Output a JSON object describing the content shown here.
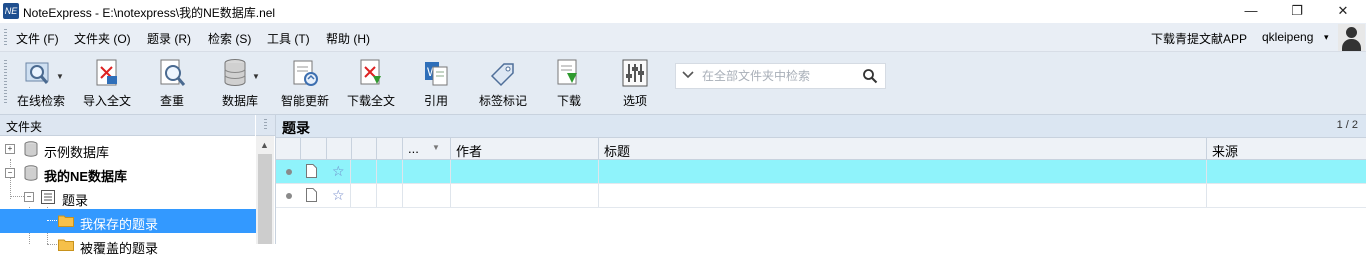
{
  "window": {
    "title": "NoteExpress - E:\\notexpress\\我的NE数据库.nel",
    "logo_text": "NE",
    "controls": {
      "minimize": "—",
      "maximize": "❐",
      "close": "✕"
    }
  },
  "menu": {
    "items": [
      "文件 (F)",
      "文件夹 (O)",
      "题录 (R)",
      "检索 (S)",
      "工具 (T)",
      "帮助 (H)"
    ],
    "download_app": "下载青提文献APP",
    "user": "qkleipeng",
    "user_caret": "▾"
  },
  "toolbar": {
    "tools": [
      {
        "label": "在线检索",
        "icon": "online-search-icon",
        "dropdown": true
      },
      {
        "label": "导入全文",
        "icon": "import-fulltext-icon"
      },
      {
        "label": "查重",
        "icon": "duplicate-check-icon"
      },
      {
        "label": "数据库",
        "icon": "database-icon",
        "dropdown": true
      },
      {
        "label": "智能更新",
        "icon": "smart-update-icon"
      },
      {
        "label": "下载全文",
        "icon": "download-fulltext-icon"
      },
      {
        "label": "引用",
        "icon": "cite-icon"
      },
      {
        "label": "标签标记",
        "icon": "tag-icon"
      },
      {
        "label": "下载",
        "icon": "download-icon"
      },
      {
        "label": "选项",
        "icon": "options-icon"
      }
    ],
    "search": {
      "placeholder": "在全部文件夹中检索",
      "value": ""
    }
  },
  "folders": {
    "header": "文件夹",
    "tree": [
      {
        "label": "示例数据库",
        "bold": false,
        "expander": "+"
      },
      {
        "label": "我的NE数据库",
        "bold": true,
        "expander": "−"
      },
      {
        "label": "题录",
        "bold": false,
        "expander": "−"
      },
      {
        "label": "我保存的题录",
        "bold": false,
        "selected": true
      },
      {
        "label": "被覆盖的题录",
        "bold": false
      }
    ]
  },
  "records": {
    "title": "题录",
    "page": "1 / 2",
    "columns": [
      "...",
      "作者",
      "标题",
      "来源"
    ],
    "sort_caret": "▼",
    "rows": [
      {
        "author": "",
        "title": "",
        "source": "",
        "highlighted": true
      },
      {
        "author": "",
        "title": "",
        "source": "",
        "highlighted": false
      }
    ]
  },
  "colors": {
    "accent_selection": "#3399ff",
    "row_highlight": "#8ff3fb",
    "toolbar_bg": "#e4ebf3",
    "menubar_bg": "#e9eef5"
  }
}
